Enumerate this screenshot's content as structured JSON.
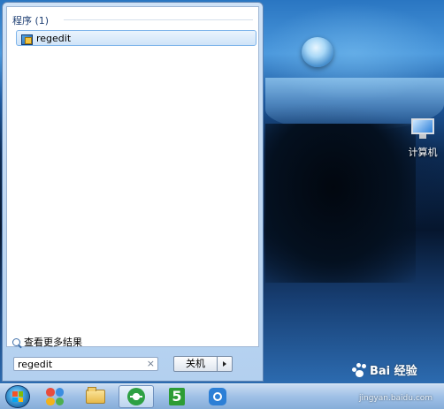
{
  "desktop": {
    "icons": [
      {
        "label": "计算机",
        "icon": "computer-icon"
      }
    ]
  },
  "start_menu": {
    "results_group": "程序 (1)",
    "results": [
      {
        "label": "regedit",
        "icon": "regedit-app-icon"
      }
    ],
    "see_more": "查看更多结果",
    "search": {
      "value": "regedit",
      "clear_icon": "×"
    },
    "shutdown_label": "关机"
  },
  "taskbar": {
    "items": [
      {
        "name": "start-button",
        "icon": "windows-orb-icon"
      },
      {
        "name": "taskbar-360",
        "icon": "360-icon"
      },
      {
        "name": "taskbar-explorer",
        "icon": "folder-icon"
      },
      {
        "name": "taskbar-browser",
        "icon": "ie-browser-icon",
        "active": true
      },
      {
        "name": "taskbar-app5",
        "icon": "green-5-icon",
        "glyph": "5"
      },
      {
        "name": "taskbar-app6",
        "icon": "blue-app-icon"
      }
    ]
  },
  "watermark": {
    "title": "Bai 经验",
    "url": "jingyan.baidu.com"
  },
  "colors": {
    "menu_bg": "#cfe2f7",
    "selection_border": "#7eb4ea",
    "taskbar": "#9fc0e6"
  }
}
